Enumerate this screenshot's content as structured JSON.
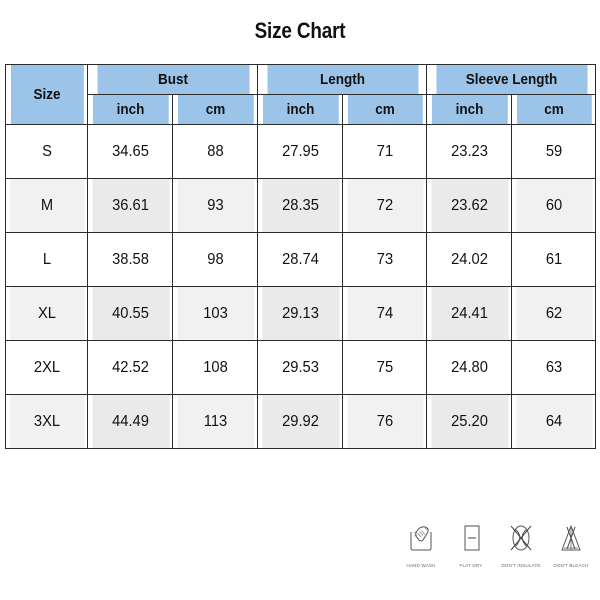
{
  "title": "Size Chart",
  "colors": {
    "header_blue": "#9cc3e8",
    "row_alt_gray": "#f1f1f1",
    "border": "#2b2b2b",
    "text": "#111111",
    "care_label": "#6a6a6a"
  },
  "table": {
    "size_header": "Size",
    "groups": [
      {
        "label": "Bust",
        "units": [
          "inch",
          "cm"
        ]
      },
      {
        "label": "Length",
        "units": [
          "inch",
          "cm"
        ]
      },
      {
        "label": "Sleeve Length",
        "units": [
          "inch",
          "cm"
        ]
      }
    ],
    "columns": [
      "Size",
      "inch",
      "cm",
      "inch",
      "cm",
      "inch",
      "cm"
    ],
    "rows": [
      {
        "size": "S",
        "bust_inch": "34.65",
        "bust_cm": "88",
        "length_inch": "27.95",
        "length_cm": "71",
        "sleeve_inch": "23.23",
        "sleeve_cm": "59"
      },
      {
        "size": "M",
        "bust_inch": "36.61",
        "bust_cm": "93",
        "length_inch": "28.35",
        "length_cm": "72",
        "sleeve_inch": "23.62",
        "sleeve_cm": "60"
      },
      {
        "size": "L",
        "bust_inch": "38.58",
        "bust_cm": "98",
        "length_inch": "28.74",
        "length_cm": "73",
        "sleeve_inch": "24.02",
        "sleeve_cm": "61"
      },
      {
        "size": "XL",
        "bust_inch": "40.55",
        "bust_cm": "103",
        "length_inch": "29.13",
        "length_cm": "74",
        "sleeve_inch": "24.41",
        "sleeve_cm": "62"
      },
      {
        "size": "2XL",
        "bust_inch": "42.52",
        "bust_cm": "108",
        "length_inch": "29.53",
        "length_cm": "75",
        "sleeve_inch": "24.80",
        "sleeve_cm": "63"
      },
      {
        "size": "3XL",
        "bust_inch": "44.49",
        "bust_cm": "113",
        "length_inch": "29.92",
        "length_cm": "76",
        "sleeve_inch": "25.20",
        "sleeve_cm": "64"
      }
    ]
  },
  "care_instructions": [
    {
      "icon": "hand-wash-icon",
      "label": "HAND WASH"
    },
    {
      "icon": "flat-dry-icon",
      "label": "FLAT DRY"
    },
    {
      "icon": "dont-insulate-icon",
      "label": "DON'T INSULATE"
    },
    {
      "icon": "dont-bleach-icon",
      "label": "DON'T BLEACH"
    }
  ]
}
